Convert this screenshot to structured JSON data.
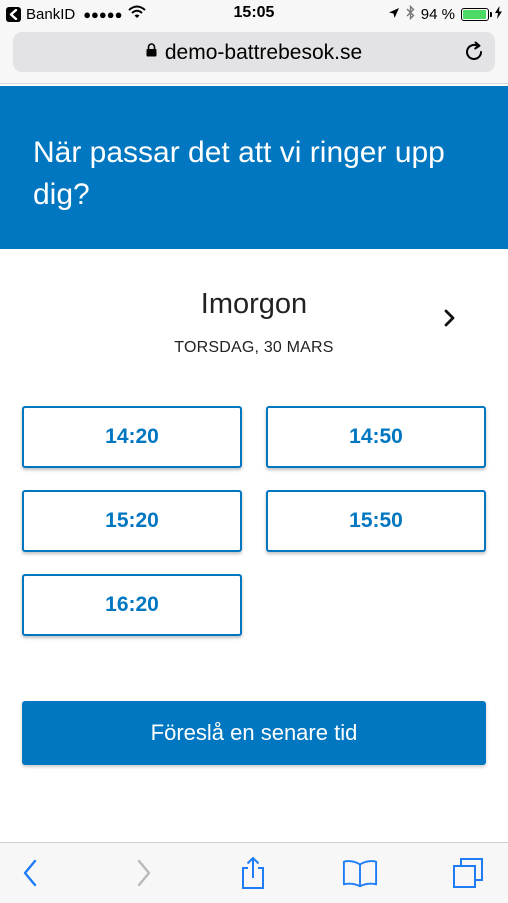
{
  "status_bar": {
    "back_app": "BankID",
    "signal": "●●●●●",
    "time": "15:05",
    "battery_text": "94 %",
    "battery_level": 0.94
  },
  "browser": {
    "url": "demo-battrebesok.se"
  },
  "hero": {
    "title": "När passar det att vi ringer upp dig?"
  },
  "day": {
    "name": "Imorgon",
    "date": "TORSDAG, 30 MARS"
  },
  "slots": [
    "14:20",
    "14:50",
    "15:20",
    "15:50",
    "16:20"
  ],
  "cta": {
    "label": "Föreslå en senare tid"
  },
  "colors": {
    "primary": "#0177c1",
    "toolbar_icon": "#1e7cf6",
    "battery": "#4cd964"
  }
}
